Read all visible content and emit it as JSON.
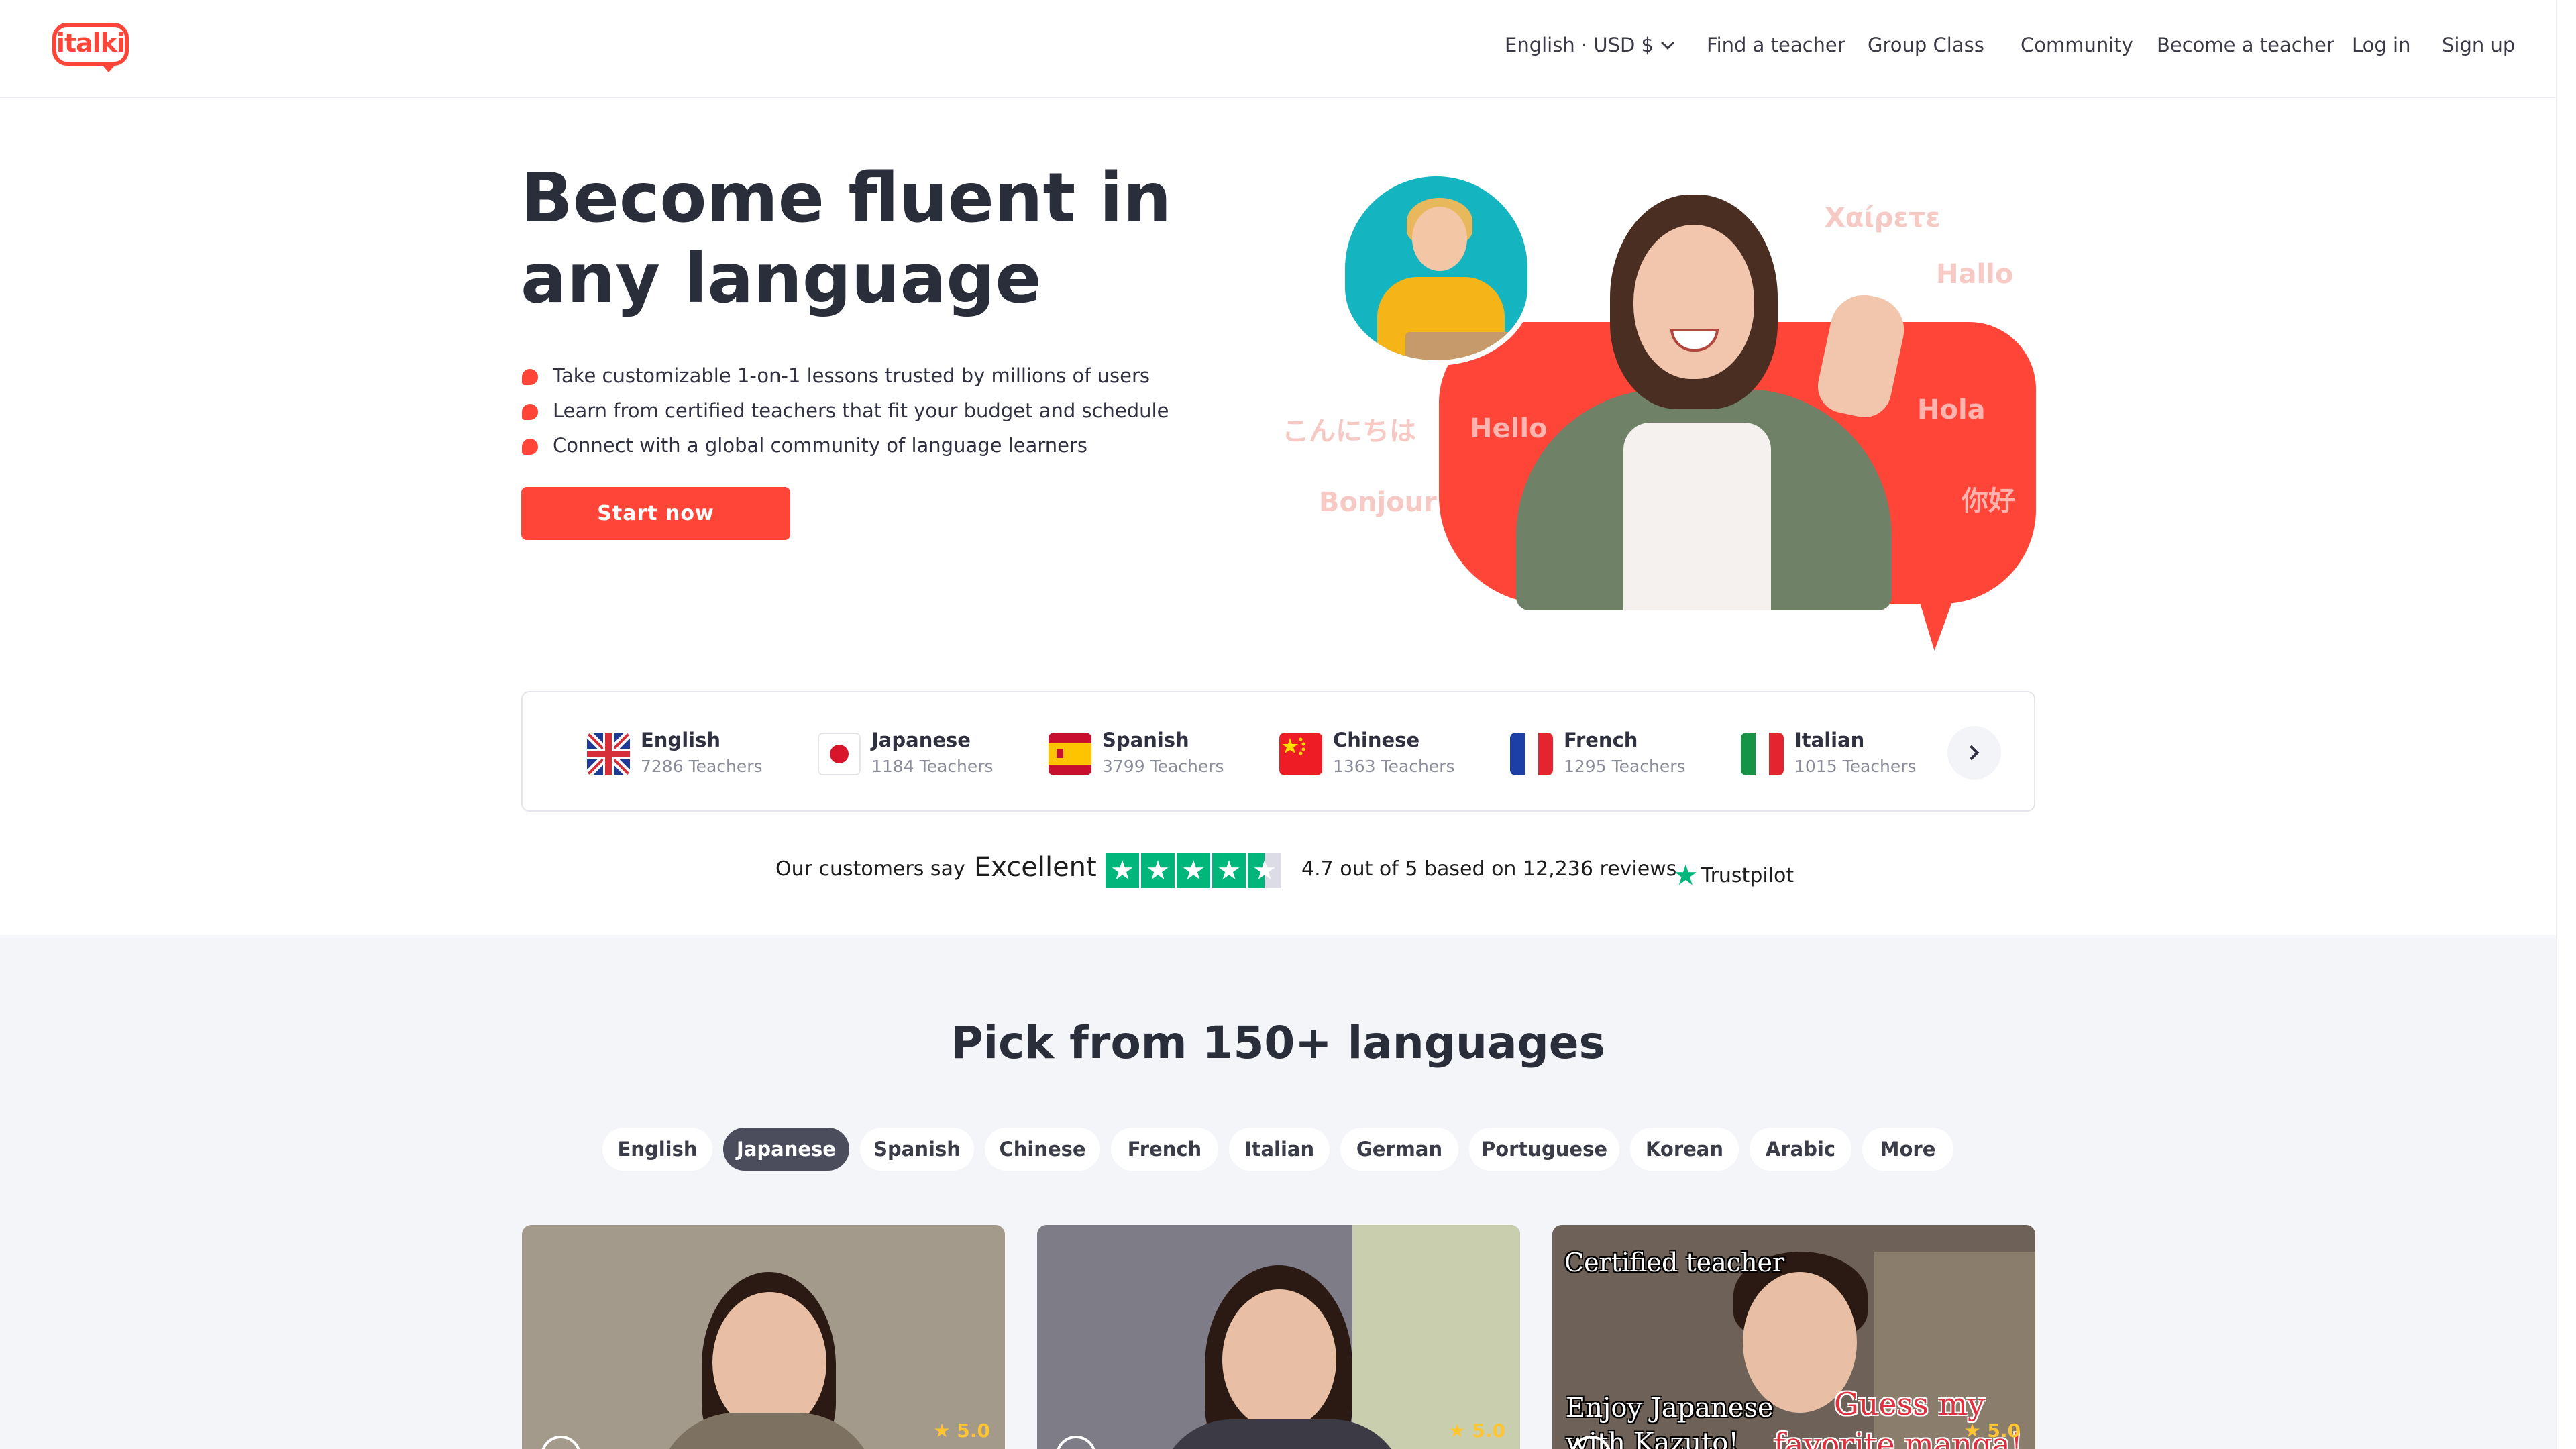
{
  "brand": {
    "logo_text": "italki",
    "accent": "#ff4438"
  },
  "nav": {
    "locale": "English · USD $",
    "find_teacher": "Find a teacher",
    "group_class": "Group Class",
    "community": "Community",
    "become_teacher": "Become a teacher",
    "login": "Log in",
    "signup": "Sign up"
  },
  "hero": {
    "title": "Become fluent in any language",
    "bullets": [
      "Take customizable 1-on-1 lessons trusted by millions of users",
      "Learn from certified teachers that fit your budget and schedule",
      "Connect with a global community of language learners"
    ],
    "cta": "Start now",
    "greetings": {
      "greek": "Χαίρετε",
      "german": "Hallo",
      "japanese": "こんにちは",
      "english": "Hello",
      "spanish": "Hola",
      "chinese": "你好",
      "french": "Bonjour"
    }
  },
  "languages": [
    {
      "name": "English",
      "count": "7286 Teachers",
      "flag": "uk-flag"
    },
    {
      "name": "Japanese",
      "count": "1184 Teachers",
      "flag": "japan-flag"
    },
    {
      "name": "Spanish",
      "count": "3799 Teachers",
      "flag": "spain-flag"
    },
    {
      "name": "Chinese",
      "count": "1363 Teachers",
      "flag": "china-flag"
    },
    {
      "name": "French",
      "count": "1295 Teachers",
      "flag": "france-flag"
    },
    {
      "name": "Italian",
      "count": "1015 Teachers",
      "flag": "italy-flag"
    }
  ],
  "trustpilot": {
    "say": "Our customers say",
    "rating_word": "Excellent",
    "summary": "4.7 out of 5 based on 12,236 reviews",
    "logo": "Trustpilot",
    "star_color": "#00b67a"
  },
  "pick": {
    "title": "Pick from 150+ languages",
    "pills": [
      "English",
      "Japanese",
      "Spanish",
      "Chinese",
      "French",
      "Italian",
      "German",
      "Portuguese",
      "Korean",
      "Arabic",
      "More"
    ],
    "active": "Japanese"
  },
  "cards": [
    {
      "rating": "5.0"
    },
    {
      "rating": "5.0"
    },
    {
      "rating": "5.0",
      "overlay_top": "Certified teacher",
      "overlay_left": "Enjoy Japanese",
      "overlay_left2": "with Kazuto!",
      "overlay_right": "Guess my",
      "overlay_right2": "favorite manga!"
    }
  ]
}
